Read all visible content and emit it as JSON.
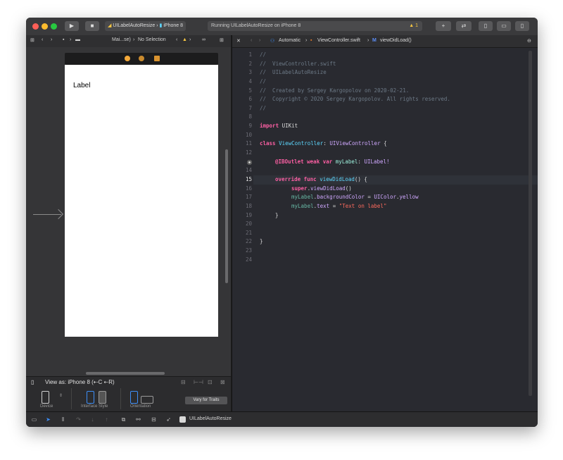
{
  "titlebar": {
    "scheme_name": "UILabelAutoResize",
    "device": "iPhone 8",
    "status": "Running UILabelAutoResize on iPhone 8",
    "warning_count": "1"
  },
  "left_jumpbar": {
    "file": "Mai...se)",
    "selection": "No Selection"
  },
  "storyboard": {
    "label_text": "Label"
  },
  "config": {
    "view_as": "View as: iPhone 8 (⇠C ⇠R)",
    "device_label": "Device",
    "interface_style_label": "Interface Style",
    "orientation_label": "Orientation",
    "vary_button": "Vary for Traits"
  },
  "editor_jumpbar": {
    "automatic": "Automatic",
    "file": "ViewController.swift",
    "symbol": "viewDidLoad()"
  },
  "code": {
    "line_numbers": [
      "1",
      "2",
      "3",
      "4",
      "5",
      "6",
      "7",
      "8",
      "9",
      "10",
      "11",
      "12",
      "13",
      "14",
      "15",
      "16",
      "17",
      "18",
      "19",
      "20",
      "21",
      "22",
      "23",
      "24"
    ],
    "l1": "//",
    "l2": "//  ViewController.swift",
    "l3": "//  UILabelAutoResize",
    "l4": "//",
    "l5": "//  Created by Sergey Kargopolov on 2020-02-21.",
    "l6": "//  Copyright © 2020 Sergey Kargopolov. All rights reserved.",
    "l7": "//",
    "import_kw": "import",
    "import_mod": "UIKit",
    "class_kw": "class",
    "class_name": "ViewController",
    "class_super": "UIViewController",
    "outlet_attr": "@IBOutlet",
    "outlet_weak": "weak",
    "outlet_var": "var",
    "outlet_name": "myLabel",
    "outlet_type": "UILabel!",
    "override_kw": "override",
    "func_kw": "func",
    "func_name": "viewDidLoad",
    "super_kw": "super",
    "super_call": "viewDidLoad",
    "mylabel": "myLabel",
    "bg_prop": "backgroundColor",
    "uicolor": "UIColor",
    "yellow": "yellow",
    "text_prop": "text",
    "string_value": "\"Text on label\""
  },
  "bottombar": {
    "target": "UILabelAutoResize"
  },
  "colors": {
    "accent_blue": "#3d8ef7",
    "warning_yellow": "#f4c542"
  }
}
